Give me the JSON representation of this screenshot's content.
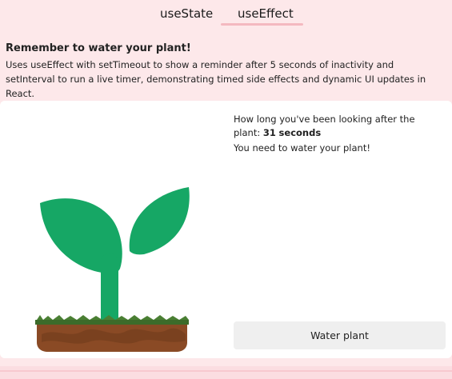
{
  "tabs": [
    {
      "label": "useState",
      "active": false
    },
    {
      "label": "useEffect",
      "active": true
    }
  ],
  "intro": {
    "title": "Remember to water your plant!",
    "description": "Uses useEffect with setTimeout to show a reminder after 5 seconds of inactivity and setInterval to run a live timer, demonstrating timed side effects and dynamic UI updates in React."
  },
  "status": {
    "timer_prefix": "How long you've been looking after the plant:",
    "timer_value": "31",
    "timer_unit": "seconds",
    "reminder": "You need to water your plant!"
  },
  "actions": {
    "water_label": "Water plant"
  },
  "colors": {
    "accent": "#f4b9c0",
    "background": "#fde8ea",
    "leaf": "#16a765",
    "soil": "#8a4a25",
    "grass": "#3c6b2a"
  },
  "icons": {
    "plant": "plant-sprout-icon"
  }
}
